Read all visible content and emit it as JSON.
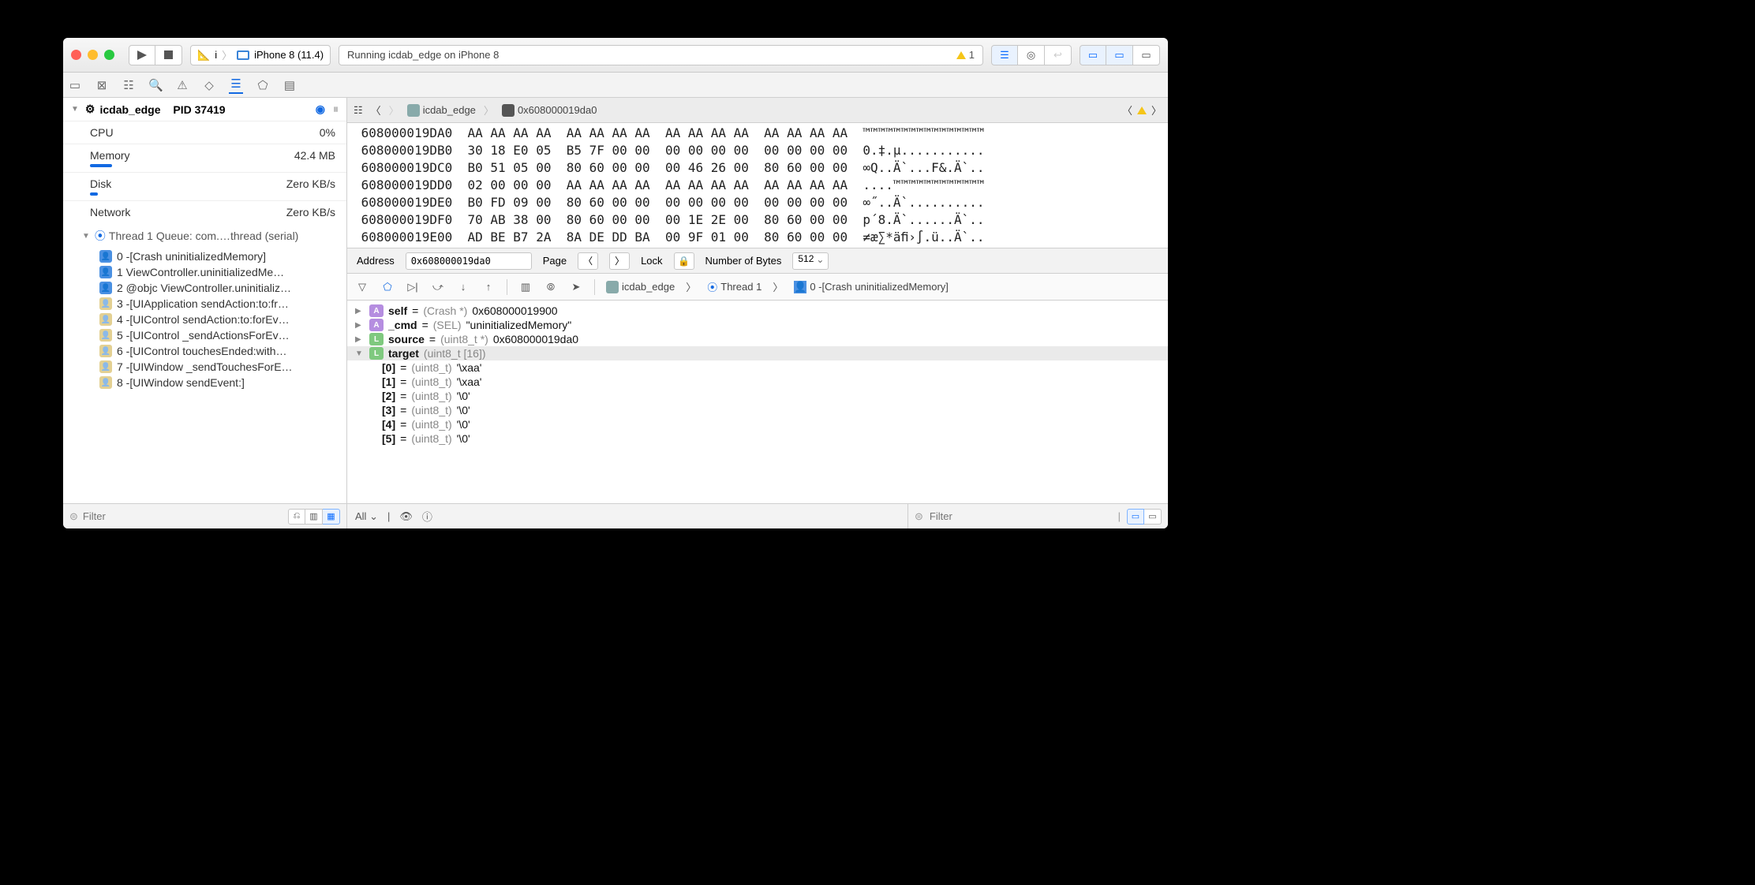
{
  "toolbar": {
    "scheme_target": "i",
    "scheme_device": "iPhone 8 (11.4)",
    "status_text": "Running icdab_edge on iPhone 8",
    "warning_count": "1"
  },
  "navigator": {
    "process_name": "icdab_edge",
    "pid_label": "PID 37419",
    "metrics": {
      "cpu_label": "CPU",
      "cpu_value": "0%",
      "mem_label": "Memory",
      "mem_value": "42.4 MB",
      "disk_label": "Disk",
      "disk_value": "Zero KB/s",
      "net_label": "Network",
      "net_value": "Zero KB/s"
    },
    "thread_header": "Thread 1 Queue: com.…thread (serial)",
    "frames": [
      {
        "idx": "0",
        "label": "-[Crash uninitializedMemory]",
        "kind": "user"
      },
      {
        "idx": "1",
        "label": "ViewController.uninitializedMe…",
        "kind": "user"
      },
      {
        "idx": "2",
        "label": "@objc ViewController.uninitializ…",
        "kind": "user"
      },
      {
        "idx": "3",
        "label": "-[UIApplication sendAction:to:fr…",
        "kind": "sys"
      },
      {
        "idx": "4",
        "label": "-[UIControl sendAction:to:forEv…",
        "kind": "sys"
      },
      {
        "idx": "5",
        "label": "-[UIControl _sendActionsForEv…",
        "kind": "sys"
      },
      {
        "idx": "6",
        "label": "-[UIControl touchesEnded:with…",
        "kind": "sys"
      },
      {
        "idx": "7",
        "label": "-[UIWindow _sendTouchesForE…",
        "kind": "sys"
      },
      {
        "idx": "8",
        "label": "-[UIWindow sendEvent:]",
        "kind": "sys"
      }
    ]
  },
  "jumpbar": {
    "item0": "icdab_edge",
    "item1": "0x608000019da0"
  },
  "hex": {
    "rows": [
      {
        "a": "608000019DA0",
        "b": "AA AA AA AA  AA AA AA AA  AA AA AA AA  AA AA AA AA",
        "c": "™™™™™™™™™™™™™™™™"
      },
      {
        "a": "608000019DB0",
        "b": "30 18 E0 05  B5 7F 00 00  00 00 00 00  00 00 00 00",
        "c": "0.‡.µ..........."
      },
      {
        "a": "608000019DC0",
        "b": "B0 51 05 00  80 60 00 00  00 46 26 00  80 60 00 00",
        "c": "∞Q..Ä`...F&.Ä`.."
      },
      {
        "a": "608000019DD0",
        "b": "02 00 00 00  AA AA AA AA  AA AA AA AA  AA AA AA AA",
        "c": "....™™™™™™™™™™™™"
      },
      {
        "a": "608000019DE0",
        "b": "B0 FD 09 00  80 60 00 00  00 00 00 00  00 00 00 00",
        "c": "∞˝..Ä`.........."
      },
      {
        "a": "608000019DF0",
        "b": "70 AB 38 00  80 60 00 00  00 1E 2E 00  80 60 00 00",
        "c": "p´8.Ä`......Ä`.."
      },
      {
        "a": "608000019E00",
        "b": "AD BE B7 2A  8A DE DD BA  00 9F 01 00  80 60 00 00",
        "c": "≠æ∑*äﬁ›∫.ü..Ä`.."
      }
    ],
    "controls": {
      "address_label": "Address",
      "address_value": "0x608000019da0",
      "page_label": "Page",
      "lock_label": "Lock",
      "bytes_label": "Number of Bytes",
      "bytes_value": "512"
    }
  },
  "debug_crumb": {
    "project": "icdab_edge",
    "thread": "Thread 1",
    "frame": "0 -[Crash uninitializedMemory]"
  },
  "variables": {
    "self": {
      "name": "self",
      "type": "(Crash *)",
      "value": "0x608000019900"
    },
    "cmd": {
      "name": "_cmd",
      "type": "(SEL)",
      "value": "\"uninitializedMemory\""
    },
    "source": {
      "name": "source",
      "type": "(uint8_t *)",
      "value": "0x608000019da0"
    },
    "target": {
      "name": "target",
      "type": "(uint8_t [16])"
    },
    "items": [
      {
        "k": "[0]",
        "t": "(uint8_t)",
        "v": "'\\xaa'"
      },
      {
        "k": "[1]",
        "t": "(uint8_t)",
        "v": "'\\xaa'"
      },
      {
        "k": "[2]",
        "t": "(uint8_t)",
        "v": "'\\0'"
      },
      {
        "k": "[3]",
        "t": "(uint8_t)",
        "v": "'\\0'"
      },
      {
        "k": "[4]",
        "t": "(uint8_t)",
        "v": "'\\0'"
      },
      {
        "k": "[5]",
        "t": "(uint8_t)",
        "v": "'\\0'"
      }
    ]
  },
  "bottom": {
    "filter_placeholder": "Filter",
    "scope_label": "All",
    "right_filter_placeholder": "Filter"
  }
}
